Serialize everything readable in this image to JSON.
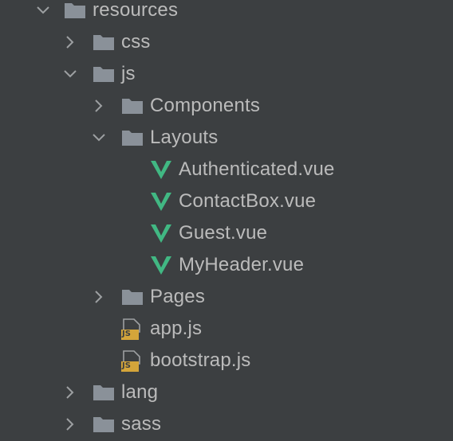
{
  "tree": {
    "resources": {
      "label": "resources",
      "expanded": true,
      "icon": "folder-icon"
    },
    "css": {
      "label": "css",
      "expanded": false,
      "icon": "folder-icon"
    },
    "js": {
      "label": "js",
      "expanded": true,
      "icon": "folder-icon"
    },
    "components": {
      "label": "Components",
      "expanded": false,
      "icon": "folder-icon"
    },
    "layouts": {
      "label": "Layouts",
      "expanded": true,
      "icon": "folder-icon"
    },
    "authenticated": {
      "label": "Authenticated.vue",
      "icon": "vue-file-icon"
    },
    "contactbox": {
      "label": "ContactBox.vue",
      "icon": "vue-file-icon"
    },
    "guest": {
      "label": "Guest.vue",
      "icon": "vue-file-icon"
    },
    "myheader": {
      "label": "MyHeader.vue",
      "icon": "vue-file-icon"
    },
    "pages": {
      "label": "Pages",
      "expanded": false,
      "icon": "folder-icon"
    },
    "appjs": {
      "label": "app.js",
      "icon": "js-file-icon"
    },
    "bootstrapjs": {
      "label": "bootstrap.js",
      "icon": "js-file-icon"
    },
    "lang": {
      "label": "lang",
      "expanded": false,
      "icon": "folder-icon"
    },
    "sass": {
      "label": "sass",
      "expanded": false,
      "icon": "folder-icon"
    }
  },
  "icons": {
    "js_badge_text": "JS"
  },
  "colors": {
    "background": "#3c3f41",
    "text": "#bbbbbb",
    "folder": "#8a9199",
    "arrow": "#9da0a2",
    "vue_green": "#41b883",
    "js_badge": "#d4a53a"
  }
}
